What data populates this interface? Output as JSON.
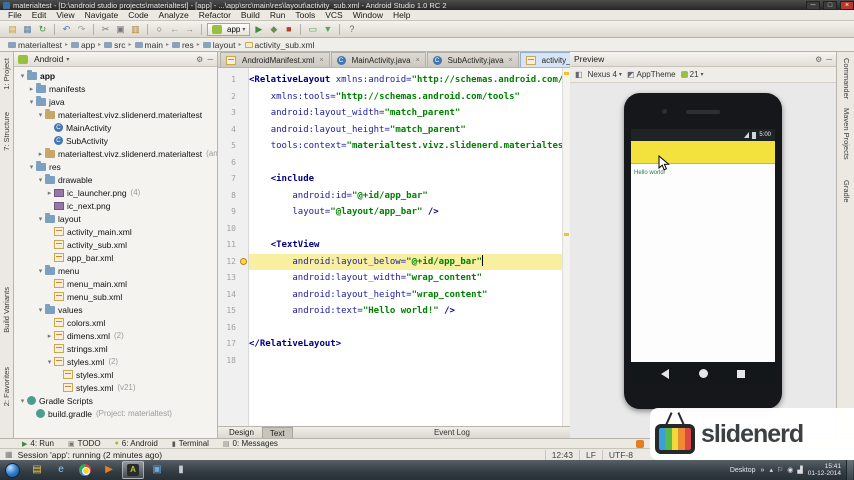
{
  "glyphs": {
    "caret": "▾",
    "bc_sep": "▸",
    "gear": "⚙",
    "hide": "─",
    "min": "─",
    "max": "□",
    "close": "×",
    "close_small": "×",
    "grid": "▦",
    "chevrons": "»",
    "arrow_expanded": "▾",
    "arrow_collapsed": "▸"
  },
  "titlebar": {
    "title": "materialtest - [D:\\android studio projects\\materialtest] - [app] - ...\\app\\src\\main\\res\\layout\\activity_sub.xml - Android Studio 1.0 RC 2"
  },
  "menubar": {
    "items": [
      "File",
      "Edit",
      "View",
      "Navigate",
      "Code",
      "Analyze",
      "Refactor",
      "Build",
      "Run",
      "Tools",
      "VCS",
      "Window",
      "Help"
    ]
  },
  "toolbar": {
    "items": [
      {
        "name": "open-project-icon",
        "glyph": "▤",
        "color": "#c9a227"
      },
      {
        "name": "save-all-icon",
        "glyph": "▦",
        "color": "#5b7fa6"
      },
      {
        "name": "sync-icon",
        "glyph": "↻",
        "color": "#3f8f3f"
      },
      {
        "sep": true
      },
      {
        "name": "undo-icon",
        "glyph": "↶",
        "color": "#4a76b8"
      },
      {
        "name": "redo-icon",
        "glyph": "↷",
        "color": "#9aa0a6"
      },
      {
        "sep": true
      },
      {
        "name": "cut-icon",
        "glyph": "✂",
        "color": "#777777"
      },
      {
        "name": "copy-icon",
        "glyph": "▣",
        "color": "#777777"
      },
      {
        "name": "paste-icon",
        "glyph": "▥",
        "color": "#b08030"
      },
      {
        "sep": true
      },
      {
        "name": "find-icon",
        "glyph": "○",
        "color": "#555555"
      },
      {
        "name": "back-arrow-icon",
        "glyph": "←",
        "color": "#888888"
      },
      {
        "name": "forward-arrow-icon",
        "glyph": "→",
        "color": "#888888"
      },
      {
        "sep": true
      },
      {
        "combo": true,
        "label": "app",
        "name": "run-configuration-combo"
      },
      {
        "name": "run-icon",
        "glyph": "▶",
        "color": "#3a8f3a"
      },
      {
        "name": "debug-icon",
        "glyph": "◆",
        "color": "#6d8a4e"
      },
      {
        "name": "stop-icon",
        "glyph": "■",
        "color": "#c0392b"
      },
      {
        "sep": true
      },
      {
        "name": "avd-manager-icon",
        "glyph": "▭",
        "color": "#58a55c"
      },
      {
        "name": "sdk-manager-icon",
        "glyph": "▼",
        "color": "#58a55c"
      },
      {
        "sep": true
      },
      {
        "name": "help-icon",
        "glyph": "?",
        "color": "#666666"
      }
    ]
  },
  "breadcrumb": {
    "items": [
      {
        "label": "materialtest",
        "type": "folder"
      },
      {
        "label": "app",
        "type": "folder"
      },
      {
        "label": "src",
        "type": "folder"
      },
      {
        "label": "main",
        "type": "folder"
      },
      {
        "label": "res",
        "type": "folder"
      },
      {
        "label": "layout",
        "type": "folder"
      },
      {
        "label": "activity_sub.xml",
        "type": "file"
      }
    ]
  },
  "strips": {
    "left": [
      "1: Project",
      "7: Structure",
      "Build Variants",
      "2: Favorites"
    ],
    "right": [
      "Commander",
      "Maven Projects",
      "Gradle"
    ]
  },
  "project_panel": {
    "title": "Android",
    "tree": [
      {
        "label": "app",
        "depth": 0,
        "icon": "folder",
        "arrow": "e",
        "bold": true
      },
      {
        "label": "manifests",
        "depth": 1,
        "icon": "folder",
        "arrow": "c"
      },
      {
        "label": "java",
        "depth": 1,
        "icon": "folder",
        "arrow": "e"
      },
      {
        "label": "materialtest.vivz.slidenerd.materialtest",
        "depth": 2,
        "icon": "package",
        "arrow": "e"
      },
      {
        "label": "MainActivity",
        "depth": 3,
        "icon": "class"
      },
      {
        "label": "SubActivity",
        "depth": 3,
        "icon": "class"
      },
      {
        "label": "materialtest.vivz.slidenerd.materialtest",
        "badge": "(androidTest)",
        "depth": 2,
        "icon": "package",
        "arrow": "c"
      },
      {
        "label": "res",
        "depth": 1,
        "icon": "folder",
        "arrow": "e"
      },
      {
        "label": "drawable",
        "depth": 2,
        "icon": "folder",
        "arrow": "e"
      },
      {
        "label": "ic_launcher.png",
        "badge": "(4)",
        "depth": 3,
        "icon": "image",
        "arrow": "c"
      },
      {
        "label": "ic_next.png",
        "depth": 3,
        "icon": "image"
      },
      {
        "label": "layout",
        "depth": 2,
        "icon": "folder",
        "arrow": "e"
      },
      {
        "label": "activity_main.xml",
        "depth": 3,
        "icon": "xml"
      },
      {
        "label": "activity_sub.xml",
        "depth": 3,
        "icon": "xml"
      },
      {
        "label": "app_bar.xml",
        "depth": 3,
        "icon": "xml"
      },
      {
        "label": "menu",
        "depth": 2,
        "icon": "folder",
        "arrow": "e"
      },
      {
        "label": "menu_main.xml",
        "depth": 3,
        "icon": "xml"
      },
      {
        "label": "menu_sub.xml",
        "depth": 3,
        "icon": "xml"
      },
      {
        "label": "values",
        "depth": 2,
        "icon": "folder",
        "arrow": "e"
      },
      {
        "label": "colors.xml",
        "depth": 3,
        "icon": "xml"
      },
      {
        "label": "dimens.xml",
        "badge": "(2)",
        "depth": 3,
        "icon": "xml",
        "arrow": "c"
      },
      {
        "label": "strings.xml",
        "depth": 3,
        "icon": "xml"
      },
      {
        "label": "styles.xml",
        "badge": "(2)",
        "depth": 3,
        "icon": "xml",
        "arrow": "e"
      },
      {
        "label": "styles.xml",
        "depth": 4,
        "icon": "xml"
      },
      {
        "label": "styles.xml",
        "badge": "(v21)",
        "depth": 4,
        "icon": "xml"
      },
      {
        "label": "Gradle Scripts",
        "depth": 0,
        "icon": "gradle",
        "arrow": "e"
      },
      {
        "label": "build.gradle",
        "badge": "(Project: materialtest)",
        "depth": 1,
        "icon": "gradle"
      }
    ]
  },
  "editor": {
    "tabs": [
      {
        "label": "AndroidManifest.xml",
        "icon": "xml",
        "active": false
      },
      {
        "label": "MainActivity.java",
        "icon": "class",
        "active": false
      },
      {
        "label": "SubActivity.java",
        "icon": "class",
        "active": false
      },
      {
        "label": "activity_sub.xml",
        "icon": "xml",
        "active": true
      }
    ],
    "lines": [
      {
        "n": 1,
        "seg": [
          [
            "t",
            "<RelativeLayout "
          ],
          [
            "a",
            "xmlns:android="
          ],
          [
            "v",
            "\"http://schemas.android.com/apk/re"
          ]
        ]
      },
      {
        "n": 2,
        "seg": [
          [
            "p",
            "    "
          ],
          [
            "a",
            "xmlns:tools="
          ],
          [
            "v",
            "\"http://schemas.android.com/tools\""
          ]
        ]
      },
      {
        "n": 3,
        "seg": [
          [
            "p",
            "    "
          ],
          [
            "a",
            "android:layout_width="
          ],
          [
            "v",
            "\"match_parent\""
          ]
        ]
      },
      {
        "n": 4,
        "seg": [
          [
            "p",
            "    "
          ],
          [
            "a",
            "android:layout_height="
          ],
          [
            "v",
            "\"match_parent\""
          ]
        ]
      },
      {
        "n": 5,
        "seg": [
          [
            "p",
            "    "
          ],
          [
            "a",
            "tools:context="
          ],
          [
            "v",
            "\"materialtest.vivz.slidenerd.materialtest.SubA"
          ]
        ]
      },
      {
        "n": 6,
        "seg": []
      },
      {
        "n": 7,
        "seg": [
          [
            "p",
            "    "
          ],
          [
            "t",
            "<include"
          ]
        ]
      },
      {
        "n": 8,
        "seg": [
          [
            "p",
            "        "
          ],
          [
            "a",
            "android:id="
          ],
          [
            "v",
            "\"@+id/app_bar\""
          ]
        ]
      },
      {
        "n": 9,
        "seg": [
          [
            "p",
            "        "
          ],
          [
            "a",
            "layout="
          ],
          [
            "v",
            "\"@layout/app_bar\""
          ],
          [
            "t",
            " />"
          ]
        ]
      },
      {
        "n": 10,
        "seg": []
      },
      {
        "n": 11,
        "seg": [
          [
            "p",
            "    "
          ],
          [
            "t",
            "<TextView"
          ]
        ]
      },
      {
        "n": 12,
        "hl": true,
        "bulb": true,
        "caret": true,
        "seg": [
          [
            "p",
            "        "
          ],
          [
            "a",
            "android:layout_below="
          ],
          [
            "v",
            "\"@+id/app_bar\""
          ]
        ]
      },
      {
        "n": 13,
        "seg": [
          [
            "p",
            "        "
          ],
          [
            "a",
            "android:layout_width="
          ],
          [
            "v",
            "\"wrap_content\""
          ]
        ]
      },
      {
        "n": 14,
        "seg": [
          [
            "p",
            "        "
          ],
          [
            "a",
            "android:layout_height="
          ],
          [
            "v",
            "\"wrap_content\""
          ]
        ]
      },
      {
        "n": 15,
        "seg": [
          [
            "p",
            "        "
          ],
          [
            "a",
            "android:text="
          ],
          [
            "v",
            "\"Hello world!\""
          ],
          [
            "t",
            " />"
          ]
        ]
      },
      {
        "n": 16,
        "seg": []
      },
      {
        "n": 17,
        "seg": [
          [
            "t",
            "</RelativeLayout>"
          ]
        ]
      },
      {
        "n": 18,
        "seg": []
      }
    ],
    "bottom_tabs": [
      {
        "label": "Design",
        "active": false
      },
      {
        "label": "Text",
        "active": true
      }
    ],
    "event_log": "Event Log"
  },
  "preview": {
    "title": "Preview",
    "device": "Nexus 4",
    "theme": "AppTheme",
    "api": "21",
    "phone": {
      "status_time": "5:00",
      "hello_text": "Hello world!"
    }
  },
  "bottom_strip": {
    "items": [
      {
        "label": "4: Run",
        "icon": "▶",
        "color": "#3a8f3a",
        "icon_name": "run-icon"
      },
      {
        "label": "TODO",
        "icon": "▣",
        "color": "#777777",
        "icon_name": "todo-icon"
      },
      {
        "label": "6: Android",
        "icon": "●",
        "color": "#97c03f",
        "icon_name": "android-icon"
      },
      {
        "label": "Terminal",
        "icon": "▮",
        "color": "#555555",
        "icon_name": "terminal-icon"
      },
      {
        "label": "0: Messages",
        "icon": "▤",
        "color": "#777777",
        "icon_name": "messages-icon"
      }
    ]
  },
  "statusbar": {
    "message": "Session 'app': running (2 minutes ago)",
    "caret_position": "12:43",
    "line_ending": "LF",
    "encoding": "UTF-8"
  },
  "taskbar": {
    "desktop_label": "Desktop",
    "time": "15:41",
    "date": "01-12-2014",
    "apps": [
      {
        "name": "taskbar-folder-icon",
        "kind": "glyph",
        "glyph": "▤",
        "color": "#e8c84a"
      },
      {
        "name": "taskbar-ie-icon",
        "kind": "glyph",
        "glyph": "e",
        "color": "#8ec9f5"
      },
      {
        "name": "taskbar-chrome-icon",
        "kind": "chrome"
      },
      {
        "name": "taskbar-media-icon",
        "kind": "glyph",
        "glyph": "▶",
        "color": "#e67e22"
      },
      {
        "name": "taskbar-android-studio-icon",
        "kind": "studio",
        "active": true,
        "glyph": "A"
      },
      {
        "name": "taskbar-blue-app-icon",
        "kind": "glyph",
        "glyph": "▣",
        "color": "#6fa8dc"
      },
      {
        "name": "taskbar-terminal-icon",
        "kind": "glyph",
        "glyph": "▮",
        "color": "#cccccc"
      }
    ],
    "tray": [
      {
        "name": "tray-expand-icon",
        "glyph": "▴"
      },
      {
        "name": "tray-flag-icon",
        "glyph": "⚐"
      },
      {
        "name": "tray-volume-icon",
        "glyph": "◉"
      },
      {
        "name": "tray-network-icon",
        "glyph": "▟"
      }
    ]
  },
  "watermark": {
    "text": "slidenerd"
  }
}
